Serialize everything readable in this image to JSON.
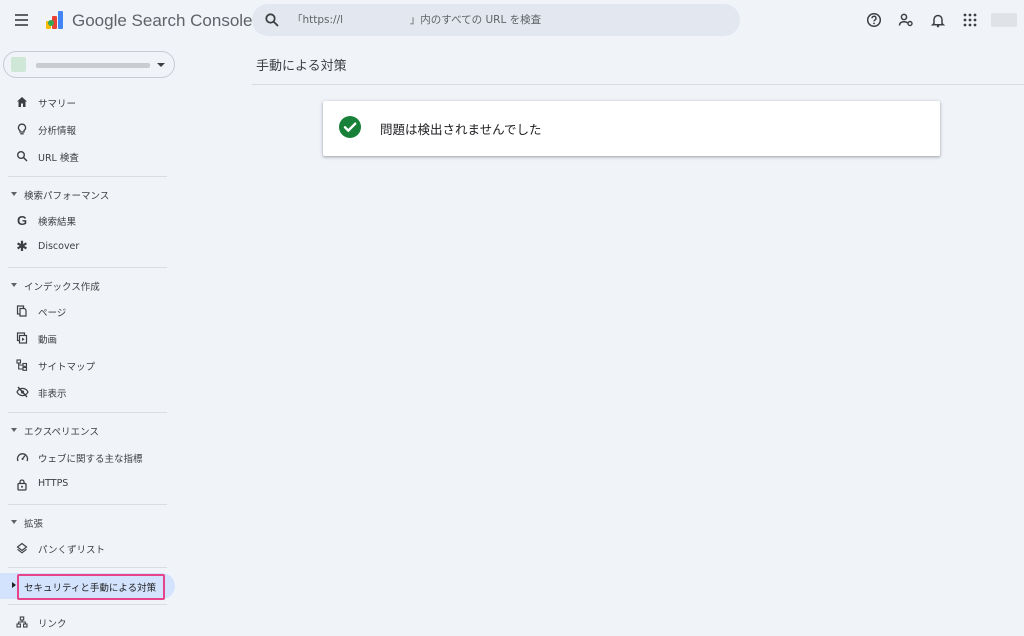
{
  "header": {
    "app_title": "Google Search Console",
    "search_placeholder": "「https://l                    」内のすべての URL を検査",
    "icons": [
      "menu-icon",
      "search-icon",
      "help-icon",
      "manage-users-icon",
      "notifications-icon",
      "apps-icon",
      "avatar"
    ]
  },
  "main": {
    "page_title": "手動による対策",
    "status_message": "問題は検出されませんでした"
  },
  "sidebar": {
    "top_items": [
      {
        "label": "サマリー",
        "icon": "home-icon"
      },
      {
        "label": "分析情報",
        "icon": "lightbulb-icon"
      },
      {
        "label": "URL 検査",
        "icon": "search-icon"
      }
    ],
    "performance": {
      "label": "検索パフォーマンス",
      "items": [
        {
          "label": "検索結果",
          "icon": "google-g-icon"
        },
        {
          "label": "Discover",
          "icon": "asterisk-icon"
        }
      ]
    },
    "indexing": {
      "label": "インデックス作成",
      "items": [
        {
          "label": "ページ",
          "icon": "pages-icon"
        },
        {
          "label": "動画",
          "icon": "video-icon"
        },
        {
          "label": "サイトマップ",
          "icon": "sitemap-icon"
        },
        {
          "label": "非表示",
          "icon": "visibility-off-icon"
        }
      ]
    },
    "experience": {
      "label": "エクスペリエンス",
      "items": [
        {
          "label": "ウェブに関する主な指標",
          "icon": "speed-icon"
        },
        {
          "label": "HTTPS",
          "icon": "lock-icon"
        }
      ]
    },
    "enhancements": {
      "label": "拡張",
      "items": [
        {
          "label": "パンくずリスト",
          "icon": "layers-icon"
        }
      ]
    },
    "security": {
      "label": "セキュリティと手動による対策"
    },
    "links": {
      "label": "リンク",
      "icon": "links-icon"
    }
  },
  "colors": {
    "background": "#f0f4f9",
    "active_item": "#d3e3fd",
    "highlight_box": "#e6438b",
    "success_green": "#188038"
  }
}
